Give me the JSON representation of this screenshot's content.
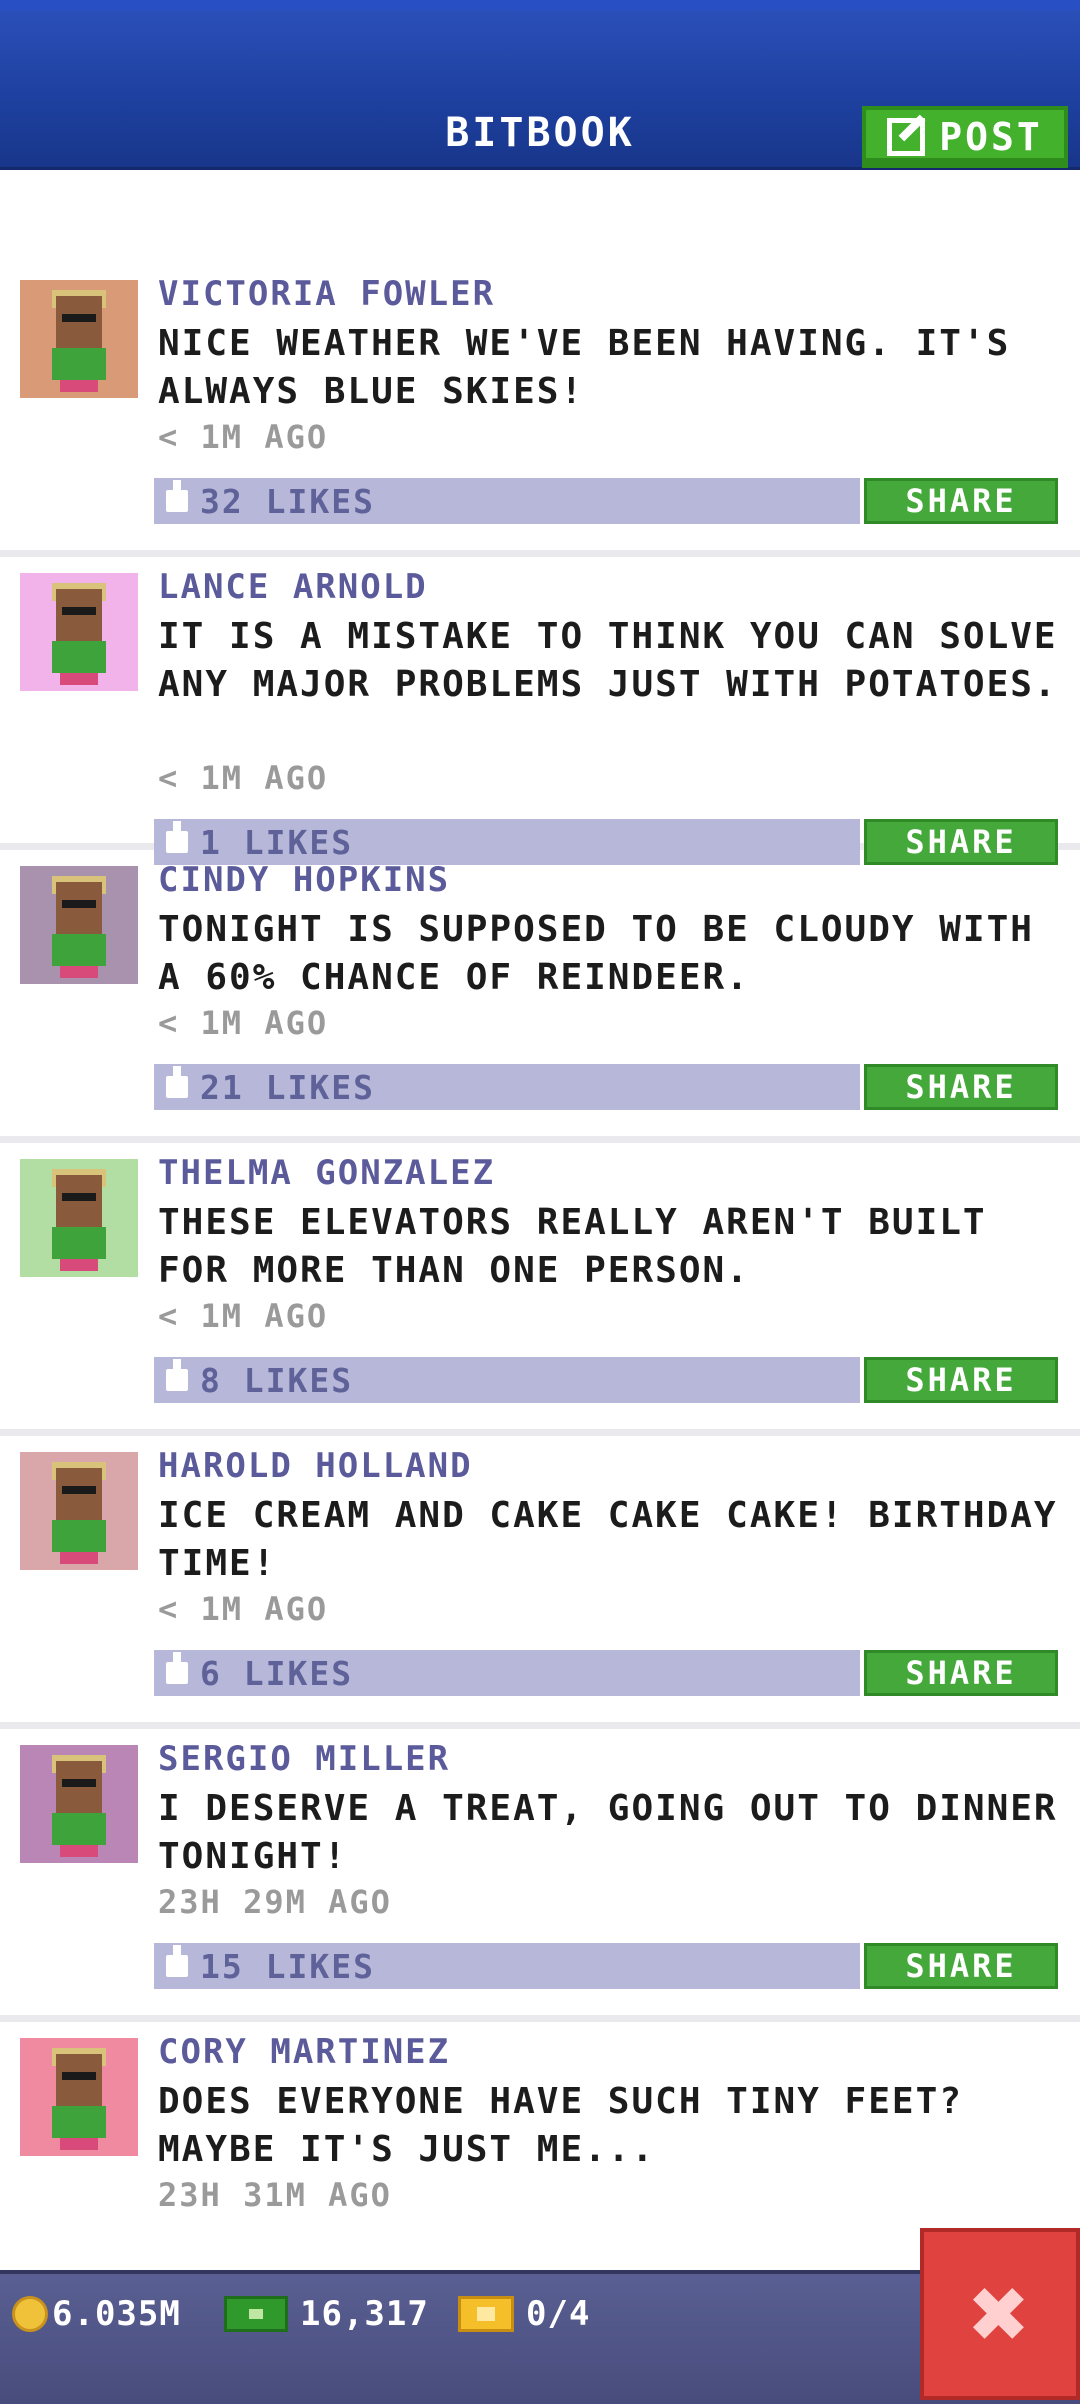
{
  "header": {
    "title": "BITBOOK",
    "post_label": "POST"
  },
  "posts": [
    {
      "author": "VICTORIA FOWLER",
      "text": "NICE WEATHER WE'VE BEEN HAVING. IT'S ALWAYS BLUE SKIES!",
      "time": "< 1M AGO",
      "likes": "32 LIKES",
      "share": "SHARE",
      "avatar_bg": "#d99a78",
      "lines": 2
    },
    {
      "author": "LANCE ARNOLD",
      "text": "IT IS A MISTAKE TO THINK YOU CAN SOLVE ANY MAJOR PROBLEMS JUST WITH POTATOES.",
      "time": "< 1M AGO",
      "likes": "1 LIKES",
      "share": "SHARE",
      "avatar_bg": "#f2b3ea",
      "lines": 3
    },
    {
      "author": "CINDY HOPKINS",
      "text": "TONIGHT IS SUPPOSED TO BE CLOUDY WITH A 60% CHANCE OF REINDEER.",
      "time": "< 1M AGO",
      "likes": "21 LIKES",
      "share": "SHARE",
      "avatar_bg": "#a892ad",
      "lines": 2
    },
    {
      "author": "THELMA GONZALEZ",
      "text": "THESE ELEVATORS REALLY AREN'T BUILT FOR MORE THAN ONE PERSON.",
      "time": "< 1M AGO",
      "likes": "8 LIKES",
      "share": "SHARE",
      "avatar_bg": "#b3dea3",
      "lines": 2
    },
    {
      "author": "HAROLD HOLLAND",
      "text": "ICE CREAM AND CAKE CAKE CAKE! BIRTHDAY TIME!",
      "time": "< 1M AGO",
      "likes": "6 LIKES",
      "share": "SHARE",
      "avatar_bg": "#d9a6a9",
      "lines": 2
    },
    {
      "author": "SERGIO MILLER",
      "text": "I DESERVE A TREAT, GOING OUT TO DINNER TONIGHT!",
      "time": "23H 29M AGO",
      "likes": "15 LIKES",
      "share": "SHARE",
      "avatar_bg": "#b986b6",
      "lines": 2
    },
    {
      "author": "CORY MARTINEZ",
      "text": "DOES EVERYONE HAVE SUCH TINY FEET? MAYBE IT'S JUST ME...",
      "time": "23H 31M AGO",
      "likes": "",
      "share": "",
      "avatar_bg": "#f08aa0",
      "lines": 2
    }
  ],
  "footer": {
    "coins": "6.035M",
    "bux": "16,317",
    "tickets": "0/4"
  }
}
